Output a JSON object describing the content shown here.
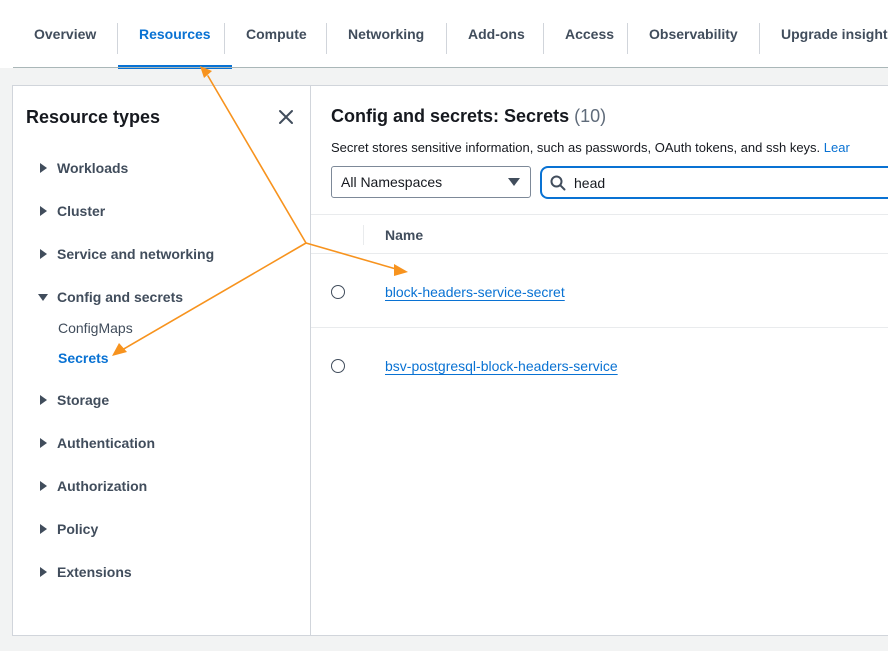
{
  "tabs": [
    {
      "label": "Overview",
      "active": false
    },
    {
      "label": "Resources",
      "active": true
    },
    {
      "label": "Compute",
      "active": false
    },
    {
      "label": "Networking",
      "active": false
    },
    {
      "label": "Add-ons",
      "active": false
    },
    {
      "label": "Access",
      "active": false
    },
    {
      "label": "Observability",
      "active": false
    },
    {
      "label": "Upgrade insights",
      "active": false
    }
  ],
  "sidebar": {
    "title": "Resource types",
    "items": [
      {
        "label": "Workloads",
        "expanded": false
      },
      {
        "label": "Cluster",
        "expanded": false
      },
      {
        "label": "Service and networking",
        "expanded": false
      },
      {
        "label": "Config and secrets",
        "expanded": true
      },
      {
        "label": "Storage",
        "expanded": false
      },
      {
        "label": "Authentication",
        "expanded": false
      },
      {
        "label": "Authorization",
        "expanded": false
      },
      {
        "label": "Policy",
        "expanded": false
      },
      {
        "label": "Extensions",
        "expanded": false
      }
    ],
    "subitems": [
      {
        "label": "ConfigMaps",
        "active": false
      },
      {
        "label": "Secrets",
        "active": true
      }
    ]
  },
  "main": {
    "title": "Config and secrets: Secrets",
    "count": "(10)",
    "description": "Secret stores sensitive information, such as passwords, OAuth tokens, and ssh keys.",
    "learn_more": "Lear",
    "namespace_select": "All Namespaces",
    "search_value": "head",
    "column_name": "Name",
    "rows": [
      {
        "name": "block-headers-service-secret"
      },
      {
        "name": "bsv-postgresql-block-headers-service"
      }
    ]
  },
  "colors": {
    "accent": "#0972d3",
    "annotation_arrow": "#f7931e"
  },
  "icons": {
    "close": "close-icon",
    "search": "search-icon",
    "caret_right": "caret-right-icon",
    "caret_down": "caret-down-icon",
    "dropdown": "triangle-down-icon"
  }
}
